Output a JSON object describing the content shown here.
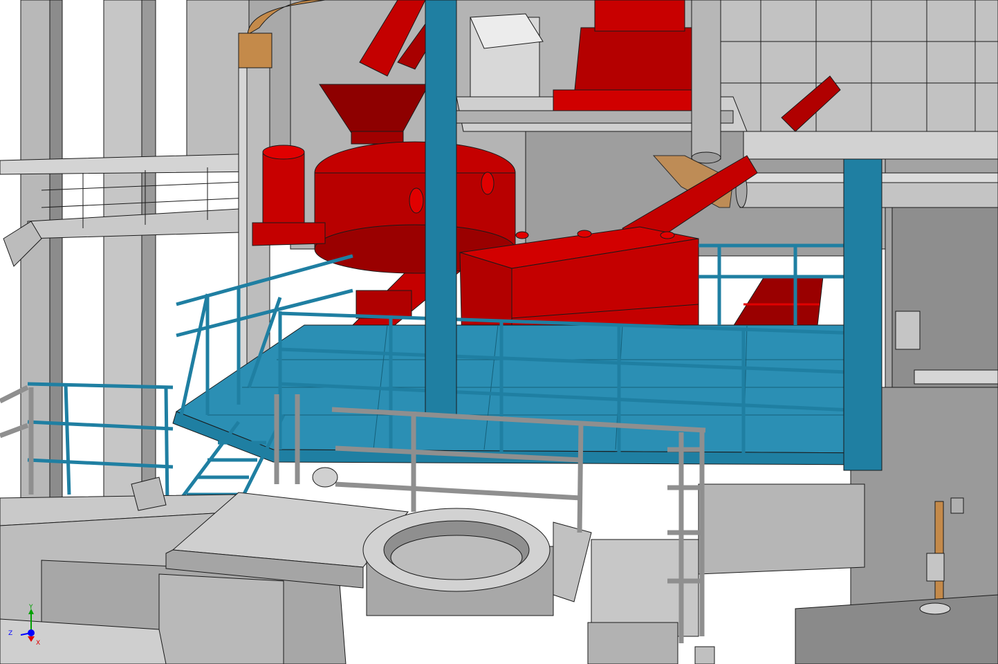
{
  "scene": {
    "kind": "cad-3d-plant-viewport",
    "components": [
      "steel-structure",
      "blue-platform",
      "red-hopper-vessel",
      "red-storage-tank",
      "red-chute-pipes",
      "red-drive-unit-frame",
      "ring-flange-opening",
      "grey-duct-pipes",
      "copper-pipes"
    ],
    "colors": {
      "background": "#ffffff",
      "steel": "#a6a6a6",
      "steel_light": "#c8c8c8",
      "steel_dark": "#7a7a7a",
      "platform_blue": "#1f7fa2",
      "platform_floor": "#2b8fb4",
      "equipment_red": "#c40000",
      "equipment_red_dark": "#8e0000",
      "copper": "#c48a4a",
      "edge": "#1a1a1a"
    }
  },
  "triad": {
    "y_label": "Y",
    "z_label": "Z",
    "x_label": "X",
    "colors": {
      "y": "#00a000",
      "z": "#0000ff",
      "x": "#e00000"
    }
  }
}
